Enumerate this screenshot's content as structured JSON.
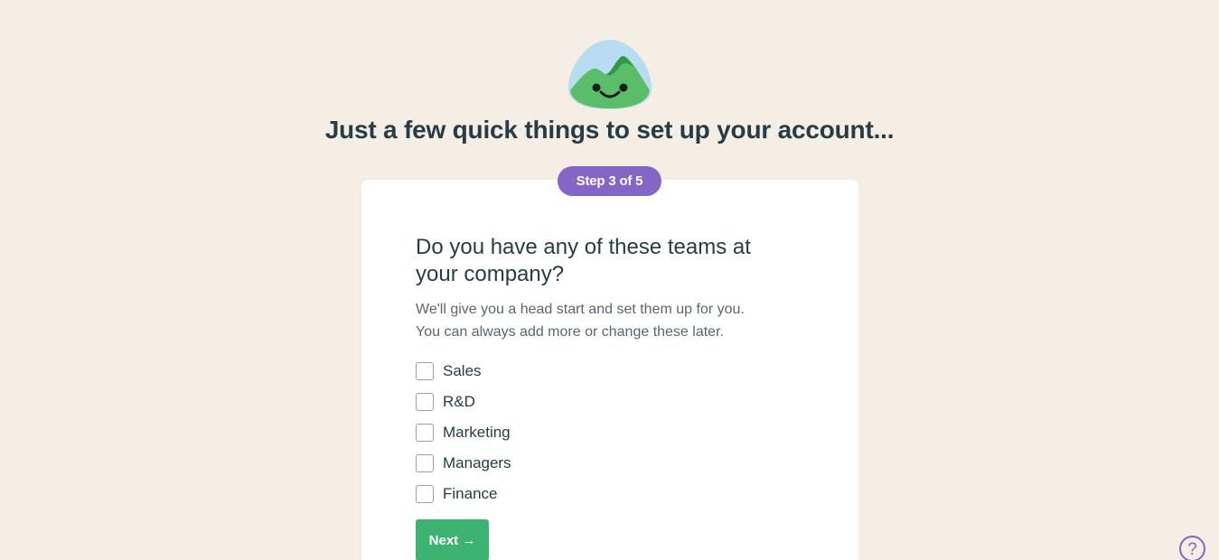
{
  "brand": {
    "logo_icon": "basecamp-mountain-smiley-icon",
    "colors": {
      "background": "#f5eee5",
      "accent_purple": "#8466c6",
      "button_green": "#3cb371",
      "logo_sky": "#b8dcf2",
      "logo_mountain": "#5bbd6a",
      "logo_peak": "#2e9a45"
    }
  },
  "headline": "Just a few quick things to set up your account...",
  "step_badge": "Step 3 of 5",
  "card": {
    "question": "Do you have any of these teams at your company?",
    "subtext_line1": "We'll give you a head start and set them up for you.",
    "subtext_line2": "You can always add more or change these later.",
    "options": [
      {
        "label": "Sales",
        "checked": false
      },
      {
        "label": "R&D",
        "checked": false
      },
      {
        "label": "Marketing",
        "checked": false
      },
      {
        "label": "Managers",
        "checked": false
      },
      {
        "label": "Finance",
        "checked": false
      }
    ],
    "next_label": "Next",
    "next_icon": "arrow-right-icon",
    "next_arrow": "→"
  },
  "help": {
    "icon": "question-mark-icon",
    "symbol": "?"
  }
}
